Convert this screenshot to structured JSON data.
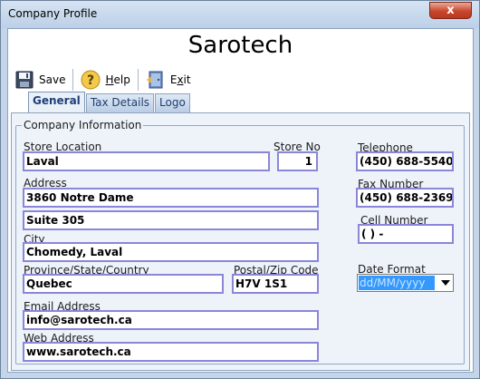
{
  "window": {
    "title": "Company Profile",
    "close_glyph": "x"
  },
  "app_title": "Sarotech",
  "toolbar": {
    "save_label": "Save",
    "help_label": "elp",
    "help_hotkey": "H",
    "exit_label": "it",
    "exit_prefix": "E",
    "exit_hotkey": "x"
  },
  "tabs": [
    {
      "label": "General",
      "active": true
    },
    {
      "label": "Tax Details",
      "active": false
    },
    {
      "label": "Logo",
      "active": false
    }
  ],
  "group": {
    "label": "Company Information"
  },
  "fields": {
    "store_location": {
      "label": "Store Location",
      "value": "Laval"
    },
    "store_no": {
      "label": "Store No",
      "value": "1"
    },
    "address": {
      "label": "Address",
      "line1": "3860 Notre Dame",
      "line2": "Suite 305"
    },
    "city": {
      "label": "City",
      "value": "Chomedy, Laval"
    },
    "province": {
      "label": "Province/State/Country",
      "value": "Quebec"
    },
    "postal": {
      "label": "Postal/Zip Code",
      "value": "H7V 1S1"
    },
    "email": {
      "label": "Email Address",
      "value": "info@sarotech.ca"
    },
    "web": {
      "label": "Web Address",
      "value": "www.sarotech.ca"
    },
    "telephone": {
      "label": "Telephone",
      "value": "(450) 688-5540"
    },
    "fax": {
      "label": "Fax Number",
      "value": "(450) 688-2369"
    },
    "cell": {
      "label": "Cell Number",
      "value": "(   )    -"
    },
    "date_format": {
      "label": "Date Format",
      "value": "dd/MM/yyyy"
    }
  },
  "colors": {
    "field_border": "#8b86d8",
    "select_highlight": "#3399ff",
    "window_frame": "#c4d5ea"
  },
  "icons": {
    "save": "floppy-disk-icon",
    "help": "question-mark-icon",
    "exit": "exit-door-icon",
    "close": "close-icon"
  }
}
